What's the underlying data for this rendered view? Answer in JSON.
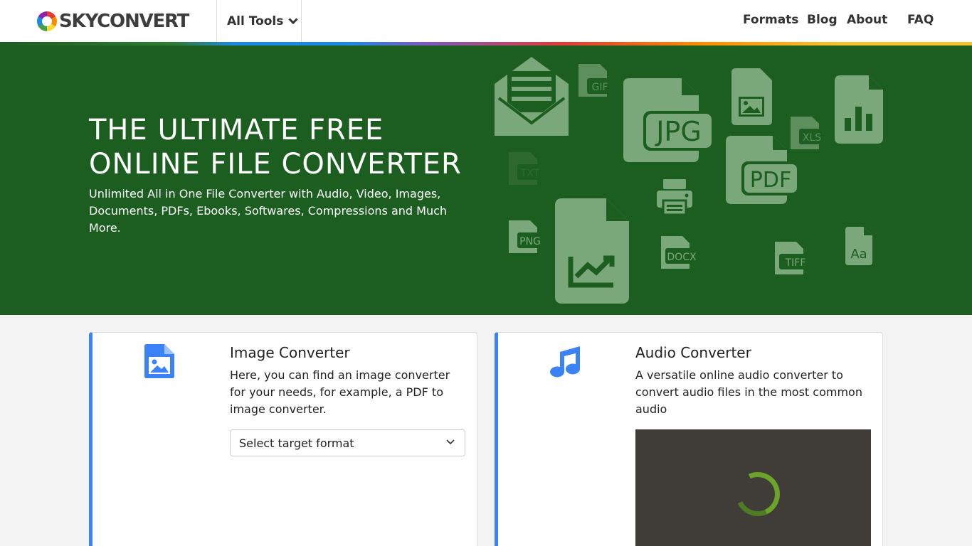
{
  "header": {
    "logo_text": "SKYCONVERT",
    "tools_label": "All Tools",
    "nav": [
      "Formats",
      "Blog",
      "About",
      "FAQ"
    ]
  },
  "hero": {
    "title": "THE ULTIMATE FREE ONLINE FILE CONVERTER",
    "subtitle": "Unlimited All in One File Converter with Audio, Video, Images, Documents, PDFs, Ebooks, Softwares, Compressions and Much More.",
    "file_labels": {
      "gif": "GIF",
      "jpg": "JPG",
      "xls": "XLS",
      "txt": "TXT",
      "pdf": "PDF",
      "png": "PNG",
      "docx": "DOCX",
      "tiff": "TIFF",
      "font": "Aa"
    }
  },
  "cards": {
    "image": {
      "title": "Image Converter",
      "description": "Here, you can find an image converter for your needs, for example, a PDF to image converter.",
      "select_placeholder": "Select target format"
    },
    "audio": {
      "title": "Audio Converter",
      "description": "A versatile online audio converter to convert audio files in the most common audio"
    }
  },
  "colors": {
    "hero_bg": "#1c5e20",
    "accent_blue": "#3b82f6",
    "icon_fill": "#7aa87a",
    "upload_bg": "#403c38",
    "spinner": "#6aa42a"
  }
}
